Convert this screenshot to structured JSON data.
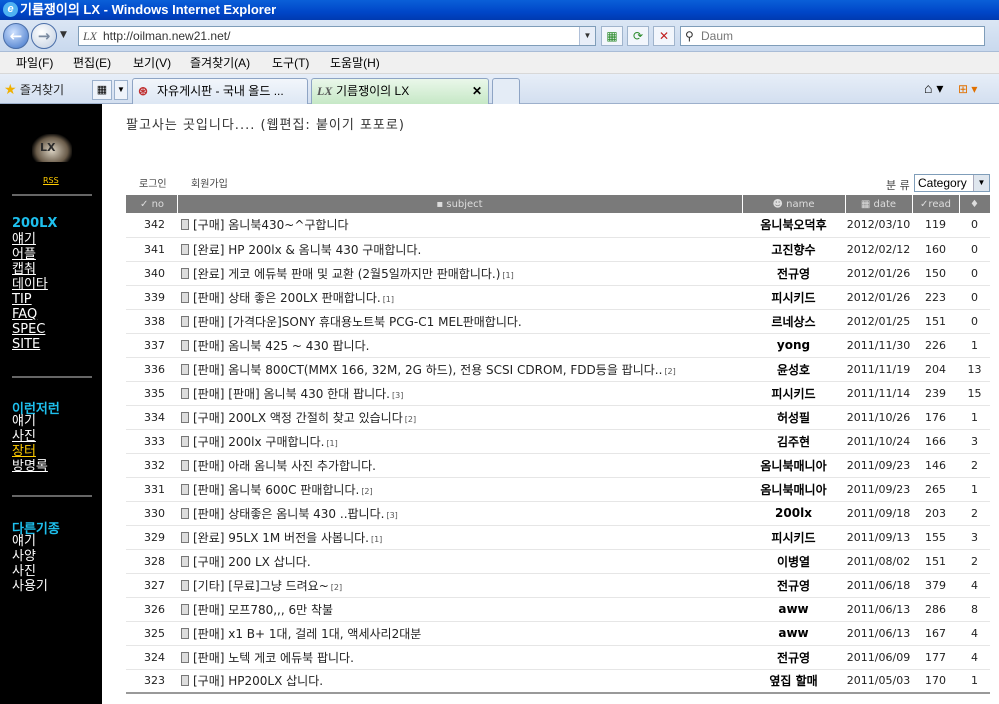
{
  "window": {
    "title": "기름쟁이의 LX - Windows Internet Explorer"
  },
  "address": {
    "url": "http://oilman.new21.net/",
    "search_placeholder": "Daum"
  },
  "menu": [
    "파일(F)",
    "편집(E)",
    "보기(V)",
    "즐겨찾기(A)",
    "도구(T)",
    "도움말(H)"
  ],
  "favorites_label": "즐겨찾기",
  "tabs": [
    {
      "label": "자유게시판 - 국내 올드 ..."
    },
    {
      "label": "기름쟁이의 LX"
    }
  ],
  "sidebar": {
    "rss": "RSS",
    "group1": {
      "title": "200LX",
      "items": [
        "얘기",
        "어플",
        "캡춰",
        "데이타",
        "TIP",
        "FAQ",
        "SPEC",
        "SITE"
      ]
    },
    "group2": {
      "title": "이런저런",
      "items": [
        "얘기",
        "사진",
        "장터",
        "방명록"
      ]
    },
    "group3": {
      "title": "다른기종",
      "items": [
        "얘기",
        "사양",
        "사진",
        "사용기"
      ]
    }
  },
  "page": {
    "heading": "팔고사는 곳입니다.... (웹편집: 붙이기 포포로)",
    "login": "로그인",
    "join": "회원가입",
    "category_label": "분 류",
    "category_value": "Category"
  },
  "columns": {
    "no": "no",
    "subject": "subject",
    "name": "name",
    "date": "date",
    "read": "read"
  },
  "posts": [
    {
      "no": "342",
      "subject": "[구매] 옴니북430~^구합니다",
      "comments": "",
      "name": "옴니북오덕후",
      "date": "2012/03/10",
      "read": "119",
      "vote": "0"
    },
    {
      "no": "341",
      "subject": "[완료] HP 200lx & 옴니북 430 구매합니다.",
      "comments": "",
      "name": "고진향수",
      "date": "2012/02/12",
      "read": "160",
      "vote": "0"
    },
    {
      "no": "340",
      "subject": "[완료] 게코 에듀북 판매 및 교환 (2월5일까지만 판매합니다.)",
      "comments": "[1]",
      "name": "전규영",
      "date": "2012/01/26",
      "read": "150",
      "vote": "0"
    },
    {
      "no": "339",
      "subject": "[판매] 상태 좋은 200LX 판매합니다.",
      "comments": "[1]",
      "name": "피시키드",
      "date": "2012/01/26",
      "read": "223",
      "vote": "0"
    },
    {
      "no": "338",
      "subject": "[판매] [가격다운]SONY 휴대용노트북 PCG-C1 MEL판매합니다.",
      "comments": "",
      "name": "르네상스",
      "date": "2012/01/25",
      "read": "151",
      "vote": "0"
    },
    {
      "no": "337",
      "subject": "[판매] 옴니북 425 ~ 430 팝니다.",
      "comments": "",
      "name": "yong",
      "date": "2011/11/30",
      "read": "226",
      "vote": "1"
    },
    {
      "no": "336",
      "subject": "[판매] 옴니북 800CT(MMX 166, 32M, 2G 하드), 전용 SCSI CDROM, FDD등을 팝니다..",
      "comments": "[2]",
      "name": "윤성호",
      "date": "2011/11/19",
      "read": "204",
      "vote": "13"
    },
    {
      "no": "335",
      "subject": "[판매] [판매] 옴니북 430 한대 팝니다.",
      "comments": "[3]",
      "name": "피시키드",
      "date": "2011/11/14",
      "read": "239",
      "vote": "15"
    },
    {
      "no": "334",
      "subject": "[구매] 200LX 액정 간절히 찾고 있습니다",
      "comments": "[2]",
      "name": "허성필",
      "date": "2011/10/26",
      "read": "176",
      "vote": "1"
    },
    {
      "no": "333",
      "subject": "[구매] 200lx 구매합니다.",
      "comments": "[1]",
      "name": "김주현",
      "date": "2011/10/24",
      "read": "166",
      "vote": "3"
    },
    {
      "no": "332",
      "subject": "[판매] 아래 옴니북 사진 추가합니다.",
      "comments": "",
      "name": "옴니북매니아",
      "date": "2011/09/23",
      "read": "146",
      "vote": "2"
    },
    {
      "no": "331",
      "subject": "[판매] 옴니북 600C 판매합니다.",
      "comments": "[2]",
      "name": "옴니북매니아",
      "date": "2011/09/23",
      "read": "265",
      "vote": "1"
    },
    {
      "no": "330",
      "subject": "[판매] 상태좋은 옴니북 430 ..팝니다.",
      "comments": "[3]",
      "name": "200lx",
      "date": "2011/09/18",
      "read": "203",
      "vote": "2"
    },
    {
      "no": "329",
      "subject": "[완료] 95LX 1M 버전을 사봅니다.",
      "comments": "[1]",
      "name": "피시키드",
      "date": "2011/09/13",
      "read": "155",
      "vote": "3"
    },
    {
      "no": "328",
      "subject": "[구매] 200 LX 삽니다.",
      "comments": "",
      "name": "이병열",
      "date": "2011/08/02",
      "read": "151",
      "vote": "2"
    },
    {
      "no": "327",
      "subject": "[기타] [무료]그냥 드려요~",
      "comments": "[2]",
      "name": "전규영",
      "date": "2011/06/18",
      "read": "379",
      "vote": "4"
    },
    {
      "no": "326",
      "subject": "[판매] 모프780,,, 6만 착불",
      "comments": "",
      "name": "aww",
      "date": "2011/06/13",
      "read": "286",
      "vote": "8"
    },
    {
      "no": "325",
      "subject": "[판매] x1 B+ 1대, 걸레 1대, 액세사리2대분",
      "comments": "",
      "name": "aww",
      "date": "2011/06/13",
      "read": "167",
      "vote": "4"
    },
    {
      "no": "324",
      "subject": "[판매] 노텍 게코 에듀북 팝니다.",
      "comments": "",
      "name": "전규영",
      "date": "2011/06/09",
      "read": "177",
      "vote": "4"
    },
    {
      "no": "323",
      "subject": "[구매] HP200LX 삽니다.",
      "comments": "",
      "name": "옆집 할매",
      "date": "2011/05/03",
      "read": "170",
      "vote": "1"
    }
  ]
}
